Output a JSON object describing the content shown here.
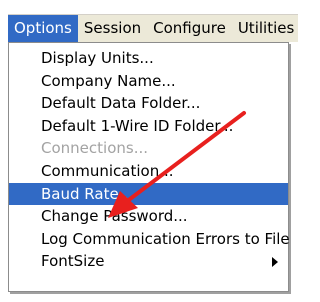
{
  "menubar": {
    "items": [
      {
        "label": "Options"
      },
      {
        "label": "Session"
      },
      {
        "label": "Configure"
      },
      {
        "label": "Utilities"
      }
    ]
  },
  "dropdown": {
    "items": [
      {
        "label": "Display Units..."
      },
      {
        "label": "Company Name..."
      },
      {
        "label": "Default Data Folder..."
      },
      {
        "label": "Default 1-Wire ID Folder..."
      },
      {
        "label": "Connections..."
      },
      {
        "label": "Communication..."
      },
      {
        "label": "Baud Rate..."
      },
      {
        "label": "Change Password..."
      },
      {
        "label": "Log Communication Errors to File"
      },
      {
        "label": "FontSize"
      }
    ]
  },
  "colors": {
    "highlight": "#316ac5",
    "annotation_arrow": "#e8201e",
    "menubar_bg": "#ece9d8",
    "disabled_text": "#a3a3a3"
  }
}
